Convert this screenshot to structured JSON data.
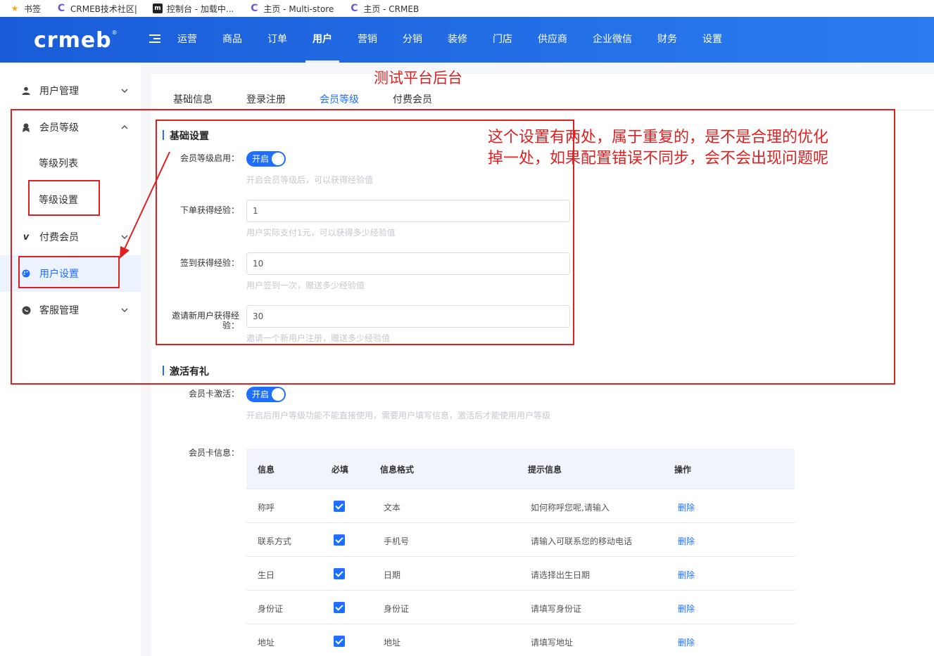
{
  "bookmarks": [
    {
      "icon": "star-icon",
      "label": "书签"
    },
    {
      "icon": "crmeb-c-icon",
      "label": "CRMEB技术社区|"
    },
    {
      "icon": "console-icon",
      "label": "控制台 - 加载中..."
    },
    {
      "icon": "crmeb-c-icon",
      "label": "主页 - Multi-store"
    },
    {
      "icon": "crmeb-c-icon",
      "label": "主页 - CRMEB"
    }
  ],
  "header": {
    "logo": "crmeb",
    "logo_mark": "®",
    "nav": [
      "运营",
      "商品",
      "订单",
      "用户",
      "营销",
      "分销",
      "装修",
      "门店",
      "供应商",
      "企业微信",
      "财务",
      "设置"
    ],
    "active_nav": "用户"
  },
  "sidebar": {
    "items": [
      {
        "label": "用户管理",
        "icon": "user-icon",
        "arrow": "⌄"
      },
      {
        "label": "会员等级",
        "icon": "vip-icon",
        "arrow": "⌃"
      },
      {
        "label": "等级列表"
      },
      {
        "label": "等级设置"
      },
      {
        "label": "付费会员",
        "icon": "vimeo-icon",
        "arrow": "⌄"
      },
      {
        "label": "用户设置",
        "icon": "palette-icon"
      },
      {
        "label": "客服管理",
        "icon": "chat-icon",
        "arrow": "⌄"
      }
    ],
    "active": "用户设置"
  },
  "tabs": [
    "基础信息",
    "登录注册",
    "会员等级",
    "付费会员"
  ],
  "active_tab": "会员等级",
  "section_basic": {
    "title": "基础设置",
    "fields": [
      {
        "label": "会员等级启用：",
        "type": "switch",
        "value": "开启",
        "help": "开启会员等级后，可以获得经验值"
      },
      {
        "label": "下单获得经验：",
        "type": "input",
        "value": "1",
        "help": "用户实际支付1元，可以获得多少经验值"
      },
      {
        "label": "签到获得经验：",
        "type": "input",
        "value": "10",
        "help": "用户签到一次，赠送多少经验值"
      },
      {
        "label_line1": "邀请新用户获得经",
        "label_line2": "验：",
        "type": "input",
        "value": "30",
        "help": "邀请一个新用户注册，赠送多少经验值"
      }
    ]
  },
  "section_activate": {
    "title": "激活有礼",
    "card_activate_label": "会员卡激活：",
    "card_activate_value": "开启",
    "card_activate_help": "开启后用户等级功能不能直接使用，需要用户填写信息，激活后才能使用用户等级",
    "card_info_label": "会员卡信息：",
    "table": {
      "headers": [
        "信息",
        "必填",
        "信息格式",
        "提示信息",
        "操作"
      ],
      "rows": [
        {
          "info": "称呼",
          "required": true,
          "format": "文本",
          "tip": "如何称呼您呢,请输入",
          "action": "删除"
        },
        {
          "info": "联系方式",
          "required": true,
          "format": "手机号",
          "tip": "请输入可联系您的移动电话",
          "action": "删除"
        },
        {
          "info": "生日",
          "required": true,
          "format": "日期",
          "tip": "请选择出生日期",
          "action": "删除"
        },
        {
          "info": "身份证",
          "required": true,
          "format": "身份证",
          "tip": "请填写身份证",
          "action": "删除"
        },
        {
          "info": "地址",
          "required": true,
          "format": "地址",
          "tip": "请填写地址",
          "action": "删除"
        }
      ]
    }
  },
  "annotations": {
    "title": "测试平台后台",
    "note_line1": "这个设置有两处，属于重复的，是不是合理的优化",
    "note_line2": "掉一处，如果配置错误不同步，会不会出现问题呢",
    "color": "#e02020"
  },
  "colors": {
    "brand": "#1e6fff",
    "header_start": "#1a5cd8",
    "header_end": "#2a7cf0"
  }
}
